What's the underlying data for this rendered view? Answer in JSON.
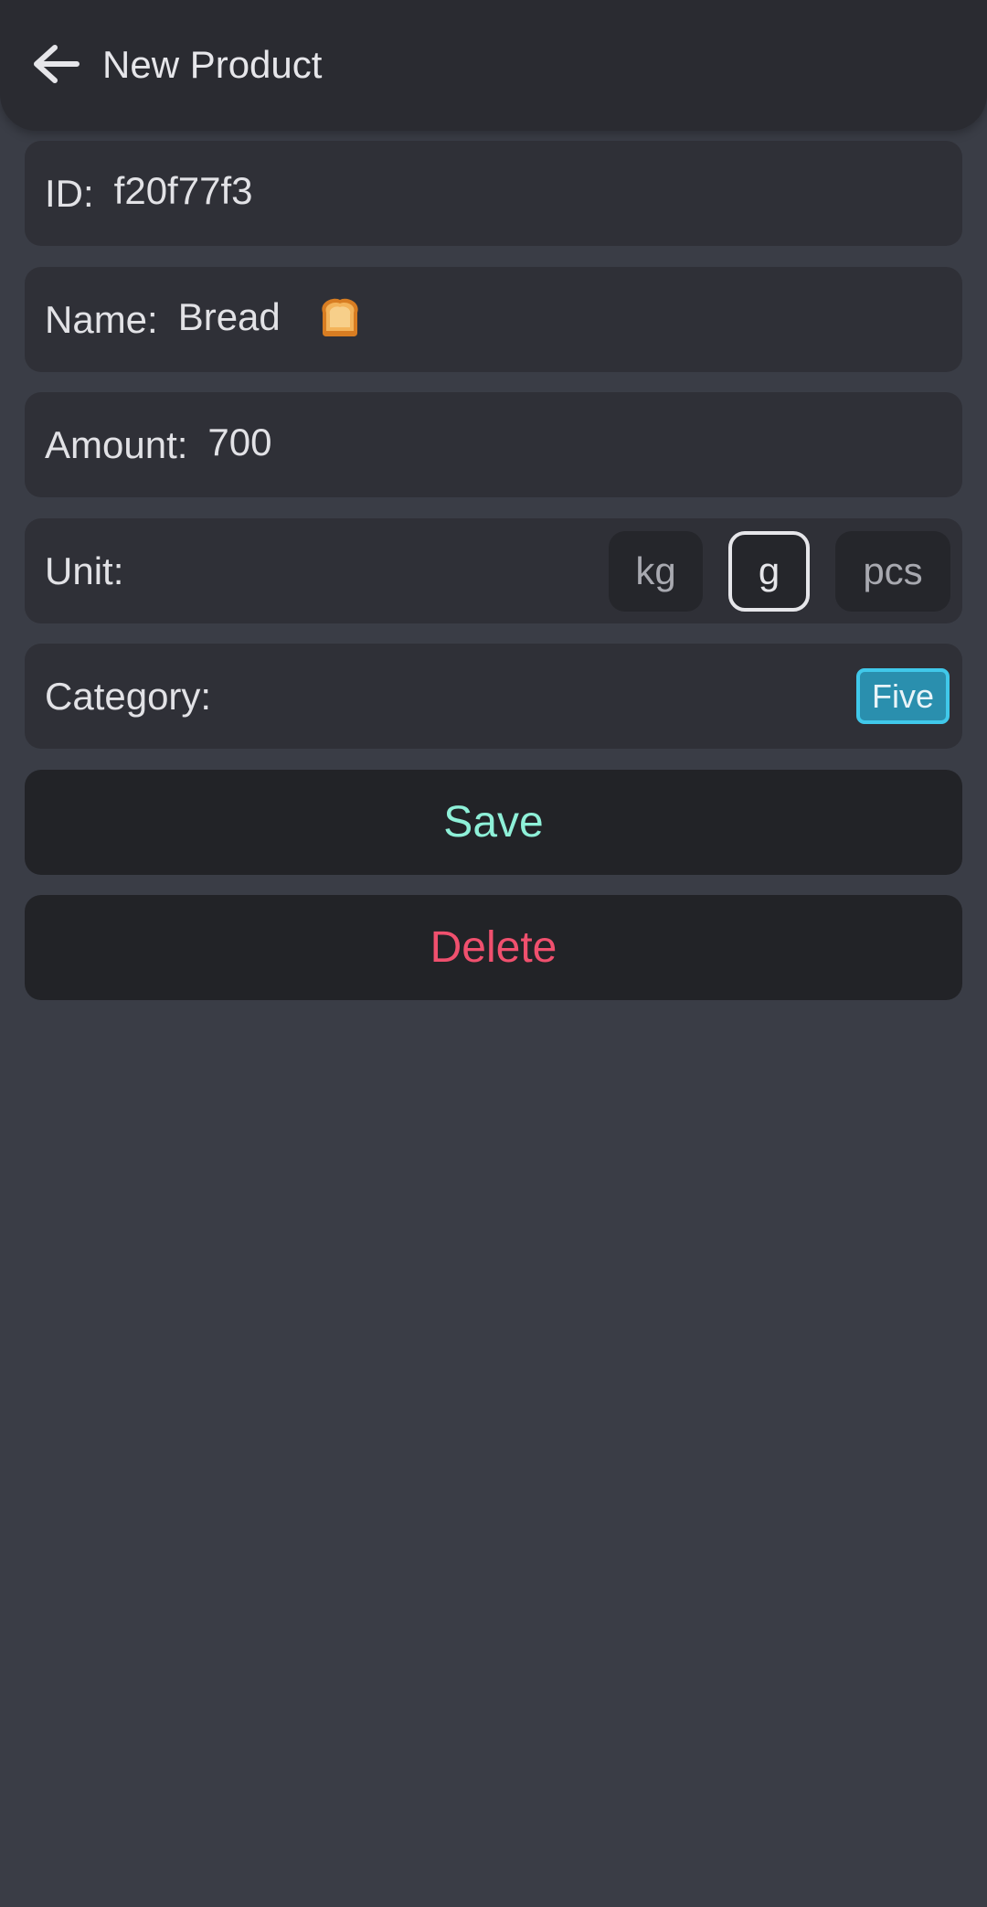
{
  "header": {
    "title": "New Product",
    "back_icon": "arrow-left-icon"
  },
  "form": {
    "id": {
      "label": "ID:",
      "value": "f20f77f3"
    },
    "name": {
      "label": "Name:",
      "value": "Bread",
      "emoji_icon": "bread-icon"
    },
    "amount": {
      "label": "Amount:",
      "value": "700"
    },
    "unit": {
      "label": "Unit:",
      "options": [
        "kg",
        "g",
        "pcs"
      ],
      "selected": "g"
    },
    "category": {
      "label": "Category:",
      "selected": "Five",
      "chip_color": "#2a8fae",
      "chip_border": "#40c8ea"
    }
  },
  "actions": {
    "save_label": "Save",
    "save_color": "#8ef0d8",
    "delete_label": "Delete",
    "delete_color": "#f0506e"
  }
}
